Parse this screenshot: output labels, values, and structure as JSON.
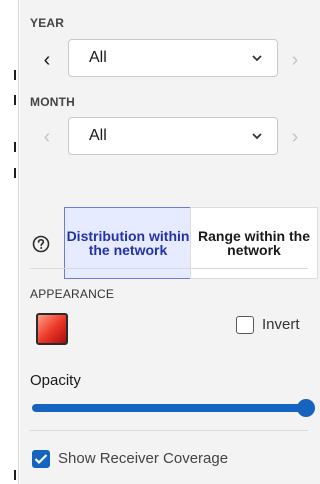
{
  "year": {
    "label": "YEAR",
    "value": "All"
  },
  "month": {
    "label": "MONTH",
    "value": "All"
  },
  "mode_toggle": {
    "options": [
      {
        "label": "Distribution within the network",
        "selected": true
      },
      {
        "label": "Range within the network",
        "selected": false
      }
    ]
  },
  "appearance": {
    "label": "APPEARANCE",
    "invert_label": "Invert",
    "invert_checked": false
  },
  "opacity": {
    "label": "Opacity",
    "value_fraction": 1.0
  },
  "receiver_coverage": {
    "label": "Show Receiver Coverage",
    "checked": true
  },
  "colors": {
    "accent": "#1565c0",
    "selected_toggle_text": "#2432a8",
    "selected_toggle_bg": "#e6ebff"
  }
}
